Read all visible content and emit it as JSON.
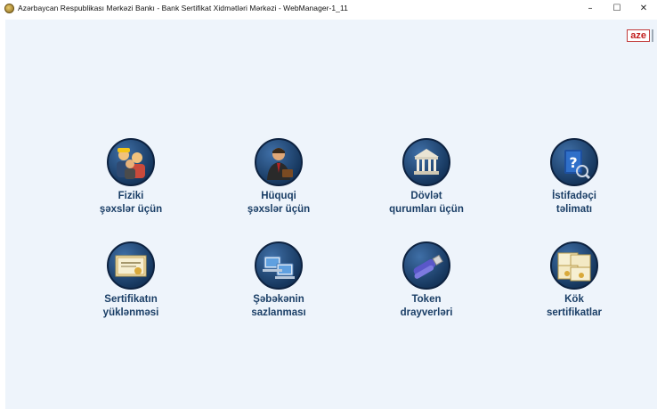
{
  "window": {
    "title": "Azərbaycan Respublikası Mərkəzi Bankı - Bank Sertifikat Xidmətləri Mərkəzi - WebManager-1_11",
    "minimize_glyph": "–",
    "maximize_glyph": "☐",
    "close_glyph": "✕"
  },
  "language": {
    "current": "aze"
  },
  "tiles": [
    {
      "line1": "Fiziki",
      "line2": "şəxslər üçün",
      "icon": "people-icon"
    },
    {
      "line1": "Hüquqi",
      "line2": "şəxslər üçün",
      "icon": "businessman-icon"
    },
    {
      "line1": "Dövlət",
      "line2": "qurumları üçün",
      "icon": "government-building-icon"
    },
    {
      "line1": "İstifadəçi",
      "line2": "təlimatı",
      "icon": "help-book-icon"
    },
    {
      "line1": "Sertifikatın",
      "line2": "yüklənməsi",
      "icon": "certificate-icon"
    },
    {
      "line1": "Şəbəkənin",
      "line2": "sazlanması",
      "icon": "network-computers-icon"
    },
    {
      "line1": "Token",
      "line2": "drayverləri",
      "icon": "usb-token-icon"
    },
    {
      "line1": "Kök",
      "line2": "sertifikatlar",
      "icon": "root-certificates-icon"
    }
  ],
  "colors": {
    "label": "#1a3e66",
    "background": "#eef4fb",
    "lang": "#c21d1d"
  }
}
